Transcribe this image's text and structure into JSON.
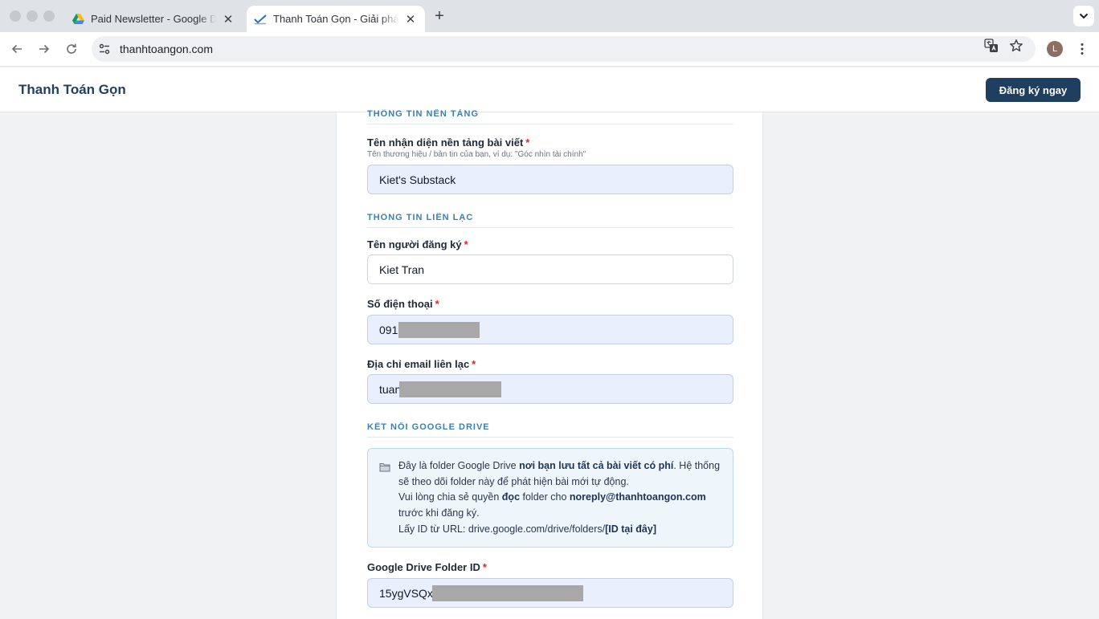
{
  "browser": {
    "tabs": [
      {
        "title": "Paid Newsletter - Google Drive",
        "active": false,
        "favicon": "google-drive-icon"
      },
      {
        "title": "Thanh Toán Gọn - Giải pháp thanh toán",
        "active": true,
        "favicon": "site-check-icon"
      }
    ],
    "url": "thanhtoangon.com",
    "profile_initial": "L"
  },
  "header": {
    "brand": "Thanh Toán Gọn",
    "cta_label": "Đăng ký ngay"
  },
  "form": {
    "section_platform": "THÔNG TIN NỀN TẢNG",
    "platform_name": {
      "label": "Tên nhận diện nền tảng bài viết",
      "required_mark": "*",
      "hint": "Tên thương hiệu / bản tin của bạn, ví dụ: \"Góc nhìn tài chính\"",
      "value": "Kiet's Substack"
    },
    "section_contact": "THÔNG TIN LIÊN LẠC",
    "registrant_name": {
      "label": "Tên người đăng ký",
      "required_mark": "*",
      "value": "Kiet Tran"
    },
    "phone": {
      "label": "Số điện thoại",
      "required_mark": "*",
      "value": "091("
    },
    "email": {
      "label": "Địa chỉ email liên lạc",
      "required_mark": "*",
      "value": "tuan"
    },
    "section_drive": "KẾT NỐI GOOGLE DRIVE",
    "drive_info": {
      "p1_a": "Đây là folder Google Drive ",
      "p1_b": "nơi bạn lưu tất cả bài viết có phí",
      "p1_c": ". Hệ thống sẽ theo dõi folder này để phát hiện bài mới tự động.",
      "p2_a": "Vui lòng chia sẻ quyền ",
      "p2_b": "đọc",
      "p2_c": " folder cho ",
      "p2_d": "noreply@thanhtoangon.com",
      "p2_e": " trước khi đăng ký.",
      "p3_a": "Lấy ID từ URL: drive.google.com/drive/folders/",
      "p3_b": "[ID tại đây]"
    },
    "drive_folder_id": {
      "label": "Google Drive Folder ID",
      "required_mark": "*",
      "value": "15ygVSQx"
    }
  },
  "colors": {
    "brand_navy": "#1f3f61",
    "section_blue": "#3b7fb8",
    "required_red": "#dc2626",
    "filled_field_bg": "#e9effd"
  }
}
